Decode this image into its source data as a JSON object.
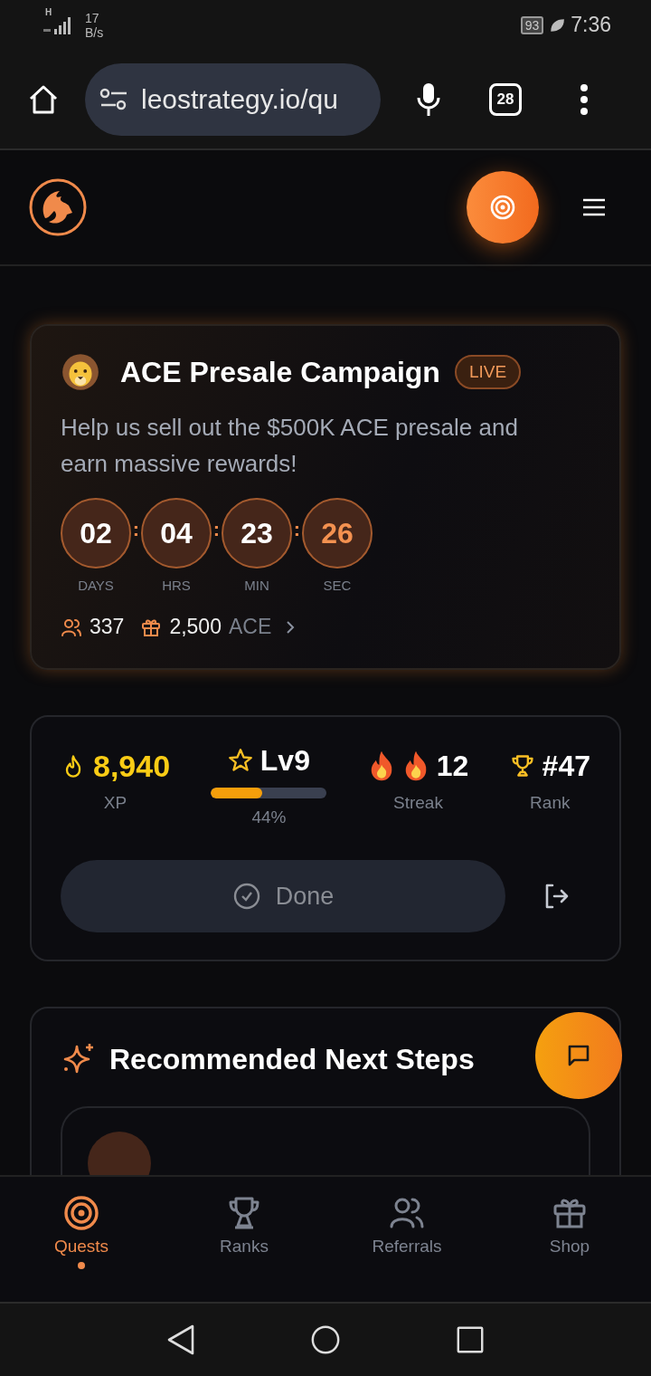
{
  "status_bar": {
    "network": "H",
    "speed": "17",
    "speed_unit": "B/s",
    "battery": "93",
    "time": "7:36"
  },
  "browser": {
    "url": "leostrategy.io/qu",
    "tab_count": "28"
  },
  "campaign": {
    "title": "ACE Presale Campaign",
    "badge": "LIVE",
    "description": "Help us sell out the $500K ACE presale and earn massive rewards!",
    "countdown": [
      {
        "value": "02",
        "label": "DAYS",
        "accent": false
      },
      {
        "value": "04",
        "label": "HRS",
        "accent": false
      },
      {
        "value": "23",
        "label": "MIN",
        "accent": false
      },
      {
        "value": "26",
        "label": "SEC",
        "accent": true
      }
    ],
    "separator": ":",
    "participants": "337",
    "reward_amount": "2,500",
    "reward_unit": "ACE"
  },
  "stats": {
    "xp": {
      "value": "8,940",
      "label": "XP"
    },
    "level": {
      "value": "Lv9",
      "level": 0.44,
      "reading": "44%"
    },
    "streak": {
      "value": "12",
      "label": "Streak"
    },
    "rank": {
      "value": "#47",
      "label": "Rank"
    }
  },
  "done_button": {
    "label": "Done",
    "disabled": true
  },
  "recommended": {
    "title": "Recommended Next Steps"
  },
  "nav": [
    {
      "label": "Quests",
      "selected": true
    },
    {
      "label": "Ranks",
      "selected": false
    },
    {
      "label": "Referrals",
      "selected": false
    },
    {
      "label": "Shop",
      "selected": false
    }
  ]
}
